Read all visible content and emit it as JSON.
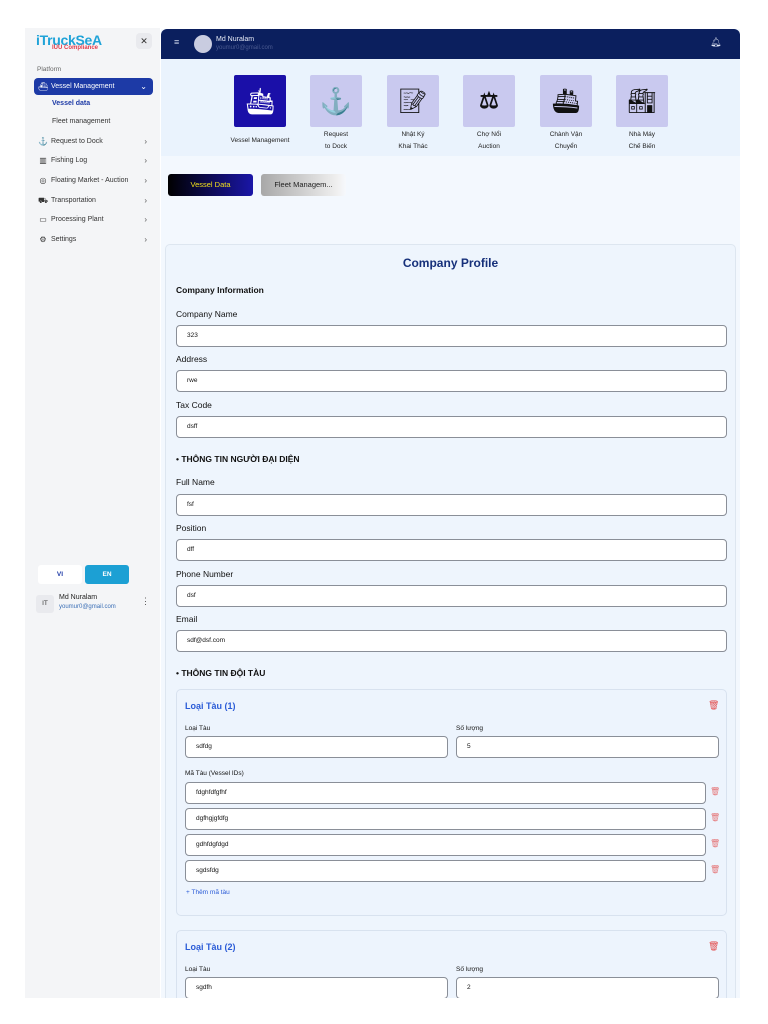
{
  "sidebar": {
    "logo": "iTruckSeA",
    "logo_sub": "IUU Compliance",
    "section": "Platform",
    "items": [
      {
        "label": "Vessel Management",
        "icon": "ship-icon"
      },
      {
        "label": "Request to Dock",
        "icon": "anchor-icon"
      },
      {
        "label": "Fishing Log",
        "icon": "map-icon"
      },
      {
        "label": "Floating Market - Auction",
        "icon": "database-icon"
      },
      {
        "label": "Transportation",
        "icon": "truck-icon"
      },
      {
        "label": "Processing Plant",
        "icon": "folder-icon"
      },
      {
        "label": "Settings",
        "icon": "gear-icon"
      }
    ],
    "subitems": [
      "Vessel data",
      "Fleet management"
    ],
    "lang": {
      "vi": "VI",
      "en": "EN"
    },
    "user": {
      "initials": "IT",
      "name": "Md Nuralam",
      "email": "youmur0@gmail.com"
    }
  },
  "header": {
    "name": "Md Nuralam",
    "email": "youmur0@gmail.com"
  },
  "tiles": [
    {
      "label1": "Vessel Management",
      "label2": ""
    },
    {
      "label1": "Request",
      "label2": "to Dock"
    },
    {
      "label1": "Nhật Ký",
      "label2": "Khai Thác"
    },
    {
      "label1": "Chợ Nổi",
      "label2": "Auction"
    },
    {
      "label1": "Chành Vận",
      "label2": "Chuyển"
    },
    {
      "label1": "Nhà Máy",
      "label2": "Chế Biến"
    }
  ],
  "tabs": [
    "Vessel Data",
    "Fleet Managem..."
  ],
  "form": {
    "title": "Company Profile",
    "company_section": "Company Information",
    "company_name": {
      "label": "Company Name",
      "value": "323"
    },
    "address": {
      "label": "Address",
      "value": "rwe"
    },
    "tax": {
      "label": "Tax Code",
      "value": "dsff"
    },
    "rep_section": "• THÔNG TIN NGƯỜI ĐẠI DIỆN",
    "full_name": {
      "label": "Full Name",
      "value": "fsf"
    },
    "position": {
      "label": "Position",
      "value": "dff"
    },
    "phone": {
      "label": "Phone Number",
      "value": "dsf"
    },
    "email": {
      "label": "Email",
      "value": "sdf@dsf.com"
    },
    "fleet_section": "• THÔNG TIN ĐỘI TÀU",
    "type_label": "Loại Tàu",
    "qty_label": "Số lượng",
    "ids_label": "Mã Tàu (Vessel IDs)",
    "add_id": "+ Thêm mã tàu",
    "fleet": [
      {
        "title": "Loại Tàu (1)",
        "type": "sdfdg",
        "qty": "5",
        "ids": [
          "fdghfdfgfhf",
          "dgfhgjgfdfg",
          "gdhfdgfdgd",
          "sgdsfdg"
        ]
      },
      {
        "title": "Loại Tàu (2)",
        "type": "sgdfh",
        "qty": "2"
      }
    ]
  }
}
